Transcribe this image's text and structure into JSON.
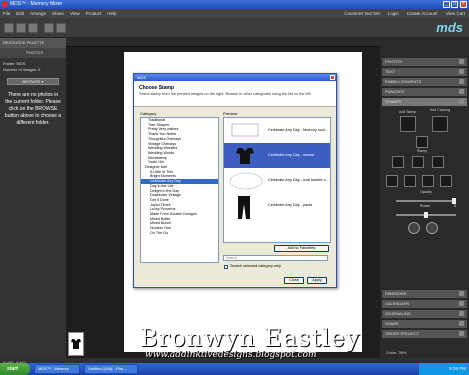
{
  "window": {
    "title": "MDS™ - Memory Mixer"
  },
  "menubar": {
    "items": [
      "File",
      "Edit",
      "Arrange",
      "Share",
      "View",
      "Product",
      "Help"
    ],
    "right_items": [
      "Countries Not Set",
      "Login",
      "Create Account",
      "View Cart"
    ]
  },
  "brand": {
    "logo": "mds",
    "section": "DESIGN CENTER"
  },
  "left_panel": {
    "header": "RESOURCE PALETTE",
    "sub_header": "PHOTOS",
    "folder_label": "Folder: MDS",
    "count_label": "Number of Images: 0",
    "browse_label": "BROWSE ▾",
    "empty_message": "There are no photos in the current folder. Please click on the BROWSE button above to choose a different folder."
  },
  "right_panel": {
    "sections_top": [
      "PHOTOS",
      "TEXT",
      "EMBELLISHMENTS",
      "PUNCHES",
      "STAMPS"
    ],
    "tool_labels": [
      "Add Stamp",
      "Add Coloring",
      "Stamp",
      "Change Color",
      "Texture",
      "Coloring",
      "Move",
      "Flip",
      "Rotate Left",
      "Rotate Right",
      "Opacity",
      "Rotate",
      "Delete"
    ],
    "opacity_value": "100",
    "rotate_value": "0",
    "sections_bottom": [
      "PHOTOS",
      "TEXT",
      "EMBELLISHMENTS",
      "PUNCHES",
      "STAMPS"
    ],
    "sections_bottom_labels": [
      "FIREWORK",
      "CALENDARS",
      "JOURNALING",
      "SHARE",
      "ORDER PROJECT"
    ]
  },
  "dialog": {
    "title": "MDS",
    "heading": "Choose Stamp",
    "description": "Select stamp from the preview images on the right. Browse to other categories using the list on the left.",
    "category_label": "Category",
    "preview_label": "Preview",
    "categories": [
      "Traditional",
      "Tree Shapes",
      "Pretty Very wishes",
      "Thank You Notes",
      "Thoughtful Overlays",
      "Vintage Overlays",
      "Wedding Wreaths",
      "Wedding Words",
      "Wordstamp",
      "Youth Girl",
      "Designer Kits",
      "A Little of This",
      "Bright Moments",
      "Celebrate Any Day",
      "Day in the Life",
      "Delight in the Day",
      "Downtown Vintage",
      "Get It Done",
      "Joyful Times",
      "Lucky Proverbs",
      "Made From Scratch Designs",
      "Mixed Bottle",
      "Mixed Bunch",
      "Number One",
      "On The Go"
    ],
    "selected_category": "Celebrate Any Day",
    "previews": [
      {
        "label": "Celebrate Any Day - Memory rock...",
        "selected": false
      },
      {
        "label": "Celebrate Any Day - onesie",
        "selected": true
      },
      {
        "label": "Celebrate Any Day - oval bubble o...",
        "selected": false
      },
      {
        "label": "Celebrate Any Day - pants",
        "selected": false
      }
    ],
    "fav_label": "Add to Favorites",
    "search_placeholder": "Search",
    "search_checkbox_label": "Search selected category only",
    "close_label": "Close",
    "apply_label": "Apply"
  },
  "watermark": {
    "name": "Bronwyn Eastley",
    "url": "www.addinktivedesigns.blogspot.com"
  },
  "status": {
    "coords": "X:496, Y:482",
    "zoom_label": "Zoom: 39%"
  },
  "taskbar": {
    "start": "start",
    "tasks": [
      "MDS™ - Memory Mixer",
      "Untitled-1(Kit) - Phe..."
    ],
    "clock": "9:26 PM"
  }
}
